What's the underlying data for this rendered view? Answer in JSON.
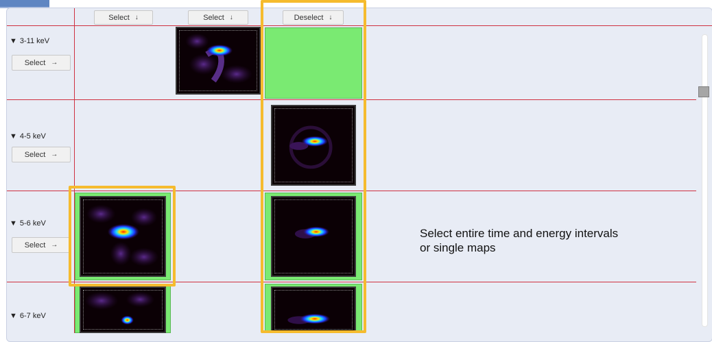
{
  "header": {
    "column_buttons": [
      {
        "label": "Select",
        "arrow": "↓"
      },
      {
        "label": "Select",
        "arrow": "↓"
      },
      {
        "label": "Deselect",
        "arrow": "↓"
      }
    ]
  },
  "rows": [
    {
      "label": "3-11 keV",
      "button_label": "Select",
      "button_arrow": "→"
    },
    {
      "label": "4-5 keV",
      "button_label": "Select",
      "button_arrow": "→"
    },
    {
      "label": "5-6 keV",
      "button_label": "Select",
      "button_arrow": "→"
    },
    {
      "label": "6-7 keV"
    }
  ],
  "caption": {
    "line1": "Select entire time and energy intervals",
    "line2": "or single maps"
  },
  "colors": {
    "background": "#e8ecf5",
    "grid_line": "#cf2f3f",
    "selected_green": "#7aea72",
    "highlight_orange": "#f5bb2e"
  },
  "icons": {
    "expand": "triangle-down-icon",
    "column_select": "arrow-down-icon",
    "row_select": "arrow-right-icon"
  }
}
